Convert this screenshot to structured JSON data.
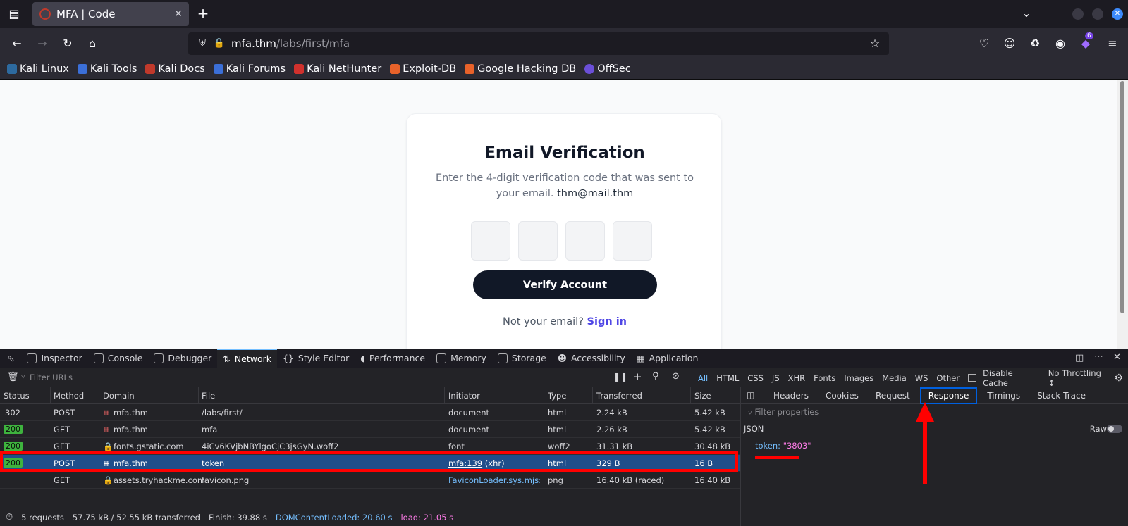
{
  "browser": {
    "tab_title": "MFA | Code",
    "url_host": "mfa.thm",
    "url_path": "/labs/first/mfa",
    "extension_badge": "6",
    "bookmarks": [
      "Kali Linux",
      "Kali Tools",
      "Kali Docs",
      "Kali Forums",
      "Kali NetHunter",
      "Exploit-DB",
      "Google Hacking DB",
      "OffSec"
    ]
  },
  "page": {
    "title": "Email Verification",
    "description": "Enter the 4-digit verification code that was sent to your email.",
    "email": "thm@mail.thm",
    "verify_button": "Verify Account",
    "not_your_email": "Not your email?",
    "sign_in": "Sign in"
  },
  "devtools": {
    "tabs": [
      "Inspector",
      "Console",
      "Debugger",
      "Network",
      "Style Editor",
      "Performance",
      "Memory",
      "Storage",
      "Accessibility",
      "Application"
    ],
    "filter_placeholder": "Filter URLs",
    "type_filters": [
      "All",
      "HTML",
      "CSS",
      "JS",
      "XHR",
      "Fonts",
      "Images",
      "Media",
      "WS",
      "Other"
    ],
    "disable_cache": "Disable Cache",
    "throttling": "No Throttling ↕",
    "columns": [
      "Status",
      "Method",
      "Domain",
      "File",
      "Initiator",
      "Type",
      "Transferred",
      "Size"
    ],
    "rows": [
      {
        "status": "302",
        "method": "POST",
        "domain": "mfa.thm",
        "file": "/labs/first/",
        "initiator": "document",
        "type": "html",
        "transferred": "2.24 kB",
        "size": "5.42 kB"
      },
      {
        "status": "200",
        "method": "GET",
        "domain": "mfa.thm",
        "file": "mfa",
        "initiator": "document",
        "type": "html",
        "transferred": "2.26 kB",
        "size": "5.42 kB"
      },
      {
        "status": "200",
        "method": "GET",
        "domain": "fonts.gstatic.com",
        "file": "4iCv6KVjbNBYlgoCjC3jsGyN.woff2",
        "initiator": "font",
        "type": "woff2",
        "transferred": "31.31 kB",
        "size": "30.48 kB"
      },
      {
        "status": "200",
        "method": "POST",
        "domain": "mfa.thm",
        "file": "token",
        "initiator": "mfa:139",
        "initiator_suffix": " (xhr)",
        "type": "html",
        "transferred": "329 B",
        "size": "16 B"
      },
      {
        "status": "",
        "method": "GET",
        "domain": "assets.tryhackme.com",
        "file": "favicon.png",
        "initiator": "FaviconLoader.sys.mjs:1...",
        "type": "png",
        "transferred": "16.40 kB (raced)",
        "size": "16.40 kB"
      }
    ],
    "summary": {
      "requests": "5 requests",
      "transferred": "57.75 kB / 52.55 kB transferred",
      "finish": "Finish: 39.88 s",
      "dcl": "DOMContentLoaded: 20.60 s",
      "load": "load: 21.05 s"
    },
    "side_tabs": [
      "Headers",
      "Cookies",
      "Request",
      "Response",
      "Timings",
      "Stack Trace"
    ],
    "side_filter": "Filter properties",
    "json_label": "JSON",
    "raw_label": "Raw",
    "token_key": "token:",
    "token_value": "\"3803\""
  },
  "colors": {
    "accent_blue": "#75bfff",
    "annotation_red": "#ff0000",
    "selected_row": "#204e8a",
    "link_purple": "#4f46e5"
  }
}
